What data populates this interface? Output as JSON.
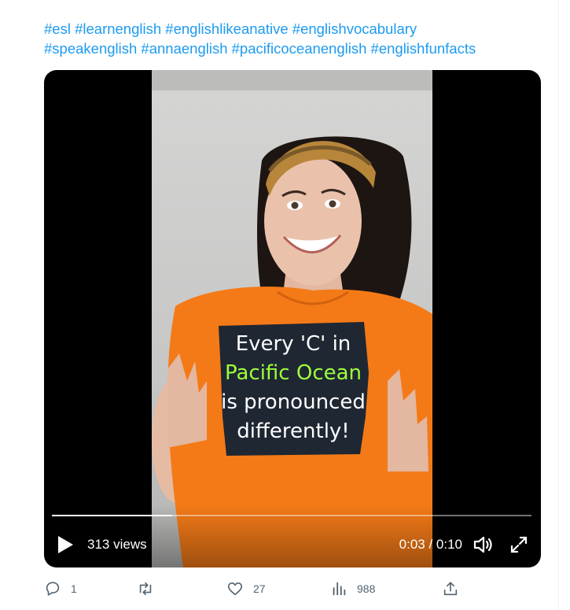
{
  "tweet": {
    "hashtags": [
      "#esl",
      "#learnenglish",
      "#englishlikeanative",
      "#englishvocabulary",
      "#speakenglish",
      "#annaenglish",
      "#pacificoceanenglish",
      "#englishfunfacts"
    ]
  },
  "video": {
    "caption_lines": [
      "Every 'C'  in",
      "Pacific Ocean",
      "is pronounced",
      "differently!"
    ],
    "caption_highlight_color": "#9dff3c",
    "views": "313 views",
    "time": "0:03 / 0:10",
    "progress": 0.25
  },
  "actions": {
    "reply_count": "1",
    "like_count": "27",
    "views_count": "988"
  },
  "icons": [
    "play-icon",
    "volume-icon",
    "fullscreen-icon",
    "reply-icon",
    "retweet-icon",
    "like-icon",
    "analytics-icon",
    "share-icon"
  ]
}
